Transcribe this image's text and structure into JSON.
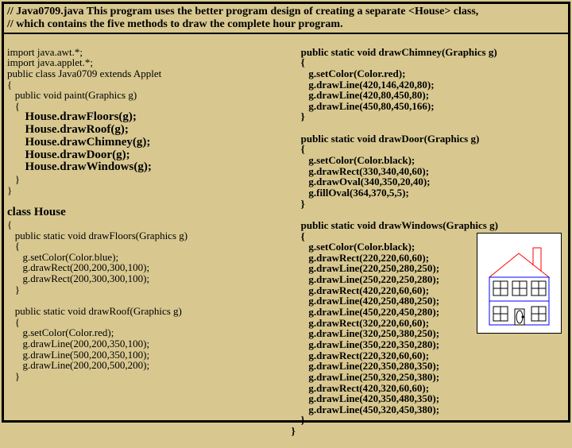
{
  "header": {
    "l1": "// Java0709.java    This program uses the better program design of creating a separate <House> class,",
    "l2": "// which contains the five methods to draw the complete hour program."
  },
  "left": {
    "c01": "import java.awt.*;",
    "c02": "import java.applet.*;",
    "c03": "public class Java0709 extends Applet",
    "c04": "{",
    "c05": "   public void paint(Graphics g)",
    "c06": "   {",
    "c07": "      House.drawFloors(g);",
    "c08": "      House.drawRoof(g);",
    "c09": "      House.drawChimney(g);",
    "c10": "      House.drawDoor(g);",
    "c11": "      House.drawWindows(g);",
    "c12": "   }",
    "c13": "}",
    "c14": "",
    "c15": "class House",
    "c16": "{",
    "c17": "   public static void drawFloors(Graphics g)",
    "c18": "   {",
    "c19": "      g.setColor(Color.blue);",
    "c20": "      g.drawRect(200,200,300,100);",
    "c21": "      g.drawRect(200,300,300,100);",
    "c22": "   }",
    "c23": "",
    "c24": "   public static void drawRoof(Graphics g)",
    "c25": "   {",
    "c26": "      g.setColor(Color.red);",
    "c27": "      g.drawLine(200,200,350,100);",
    "c28": "      g.drawLine(500,200,350,100);",
    "c29": "      g.drawLine(200,200,500,200);",
    "c30": "   }"
  },
  "right": {
    "c01": "public static void drawChimney(Graphics g)",
    "c02": "{",
    "c03": "   g.setColor(Color.red);",
    "c04": "   g.drawLine(420,146,420,80);",
    "c05": "   g.drawLine(420,80,450,80);",
    "c06": "   g.drawLine(450,80,450,166);",
    "c07": "}",
    "c08": "",
    "c09": "public static void drawDoor(Graphics g)",
    "c10": "{",
    "c11": "   g.setColor(Color.black);",
    "c12": "   g.drawRect(330,340,40,60);",
    "c13": "   g.drawOval(340,350,20,40);",
    "c14": "   g.fillOval(364,370,5,5);",
    "c15": "}",
    "c16": "",
    "c17": "public static void drawWindows(Graphics g)",
    "c18": "{",
    "c19": "   g.setColor(Color.black);",
    "c20": "   g.drawRect(220,220,60,60);",
    "c21": "   g.drawLine(220,250,280,250);",
    "c22": "   g.drawLine(250,220,250,280);",
    "c23": "   g.drawRect(420,220,60,60);",
    "c24": "   g.drawLine(420,250,480,250);",
    "c25": "   g.drawLine(450,220,450,280);",
    "c26": "   g.drawRect(320,220,60,60);",
    "c27": "   g.drawLine(320,250,380,250);",
    "c28": "   g.drawLine(350,220,350,280);",
    "c29": "   g.drawRect(220,320,60,60);",
    "c30": "   g.drawLine(220,350,280,350);",
    "c31": "   g.drawLine(250,320,250,380);",
    "c32": "   g.drawRect(420,320,60,60);",
    "c33": "   g.drawLine(420,350,480,350);",
    "c34": "   g.drawLine(450,320,450,380);",
    "c35": "}",
    "c36": "}"
  }
}
